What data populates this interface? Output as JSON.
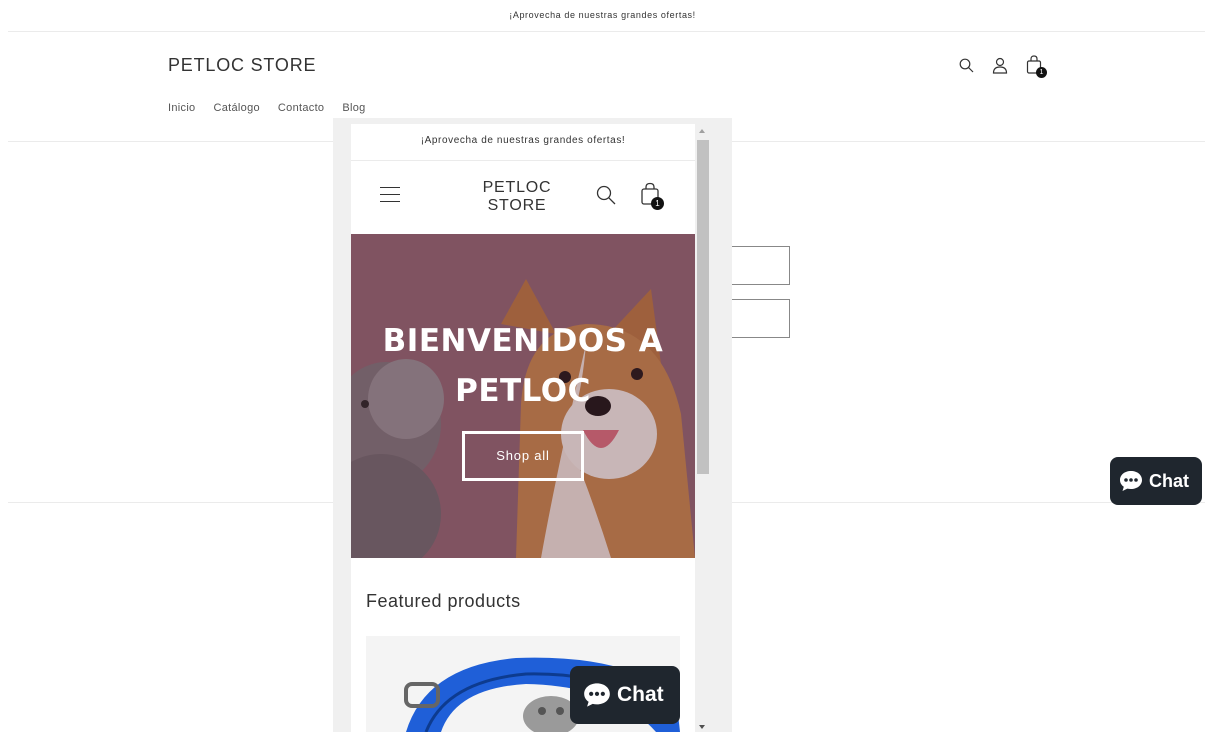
{
  "announcement": "¡Aprovecha de nuestras grandes ofertas!",
  "brand": "PETLOC STORE",
  "nav": [
    "Inicio",
    "Catálogo",
    "Contacto",
    "Blog"
  ],
  "cart_count": "1",
  "mobile": {
    "announcement": "¡Aprovecha de nuestras grandes ofertas!",
    "brand_line1": "PETLOC",
    "brand_line2": "STORE",
    "cart_count": "1",
    "hero_title_line1": "BIENVENIDOS A",
    "hero_title_line2": "PETLOC",
    "hero_button": "Shop all",
    "featured_title": "Featured products"
  },
  "chat_label": "Chat",
  "icons": {
    "search": "search-icon",
    "account": "account-icon",
    "cart": "cart-icon",
    "menu": "hamburger-menu-icon",
    "chat": "chat-bubble-icon"
  },
  "colors": {
    "chat_bg": "#1f262e",
    "hero_overlay": "#7a5560",
    "text": "#121212"
  }
}
